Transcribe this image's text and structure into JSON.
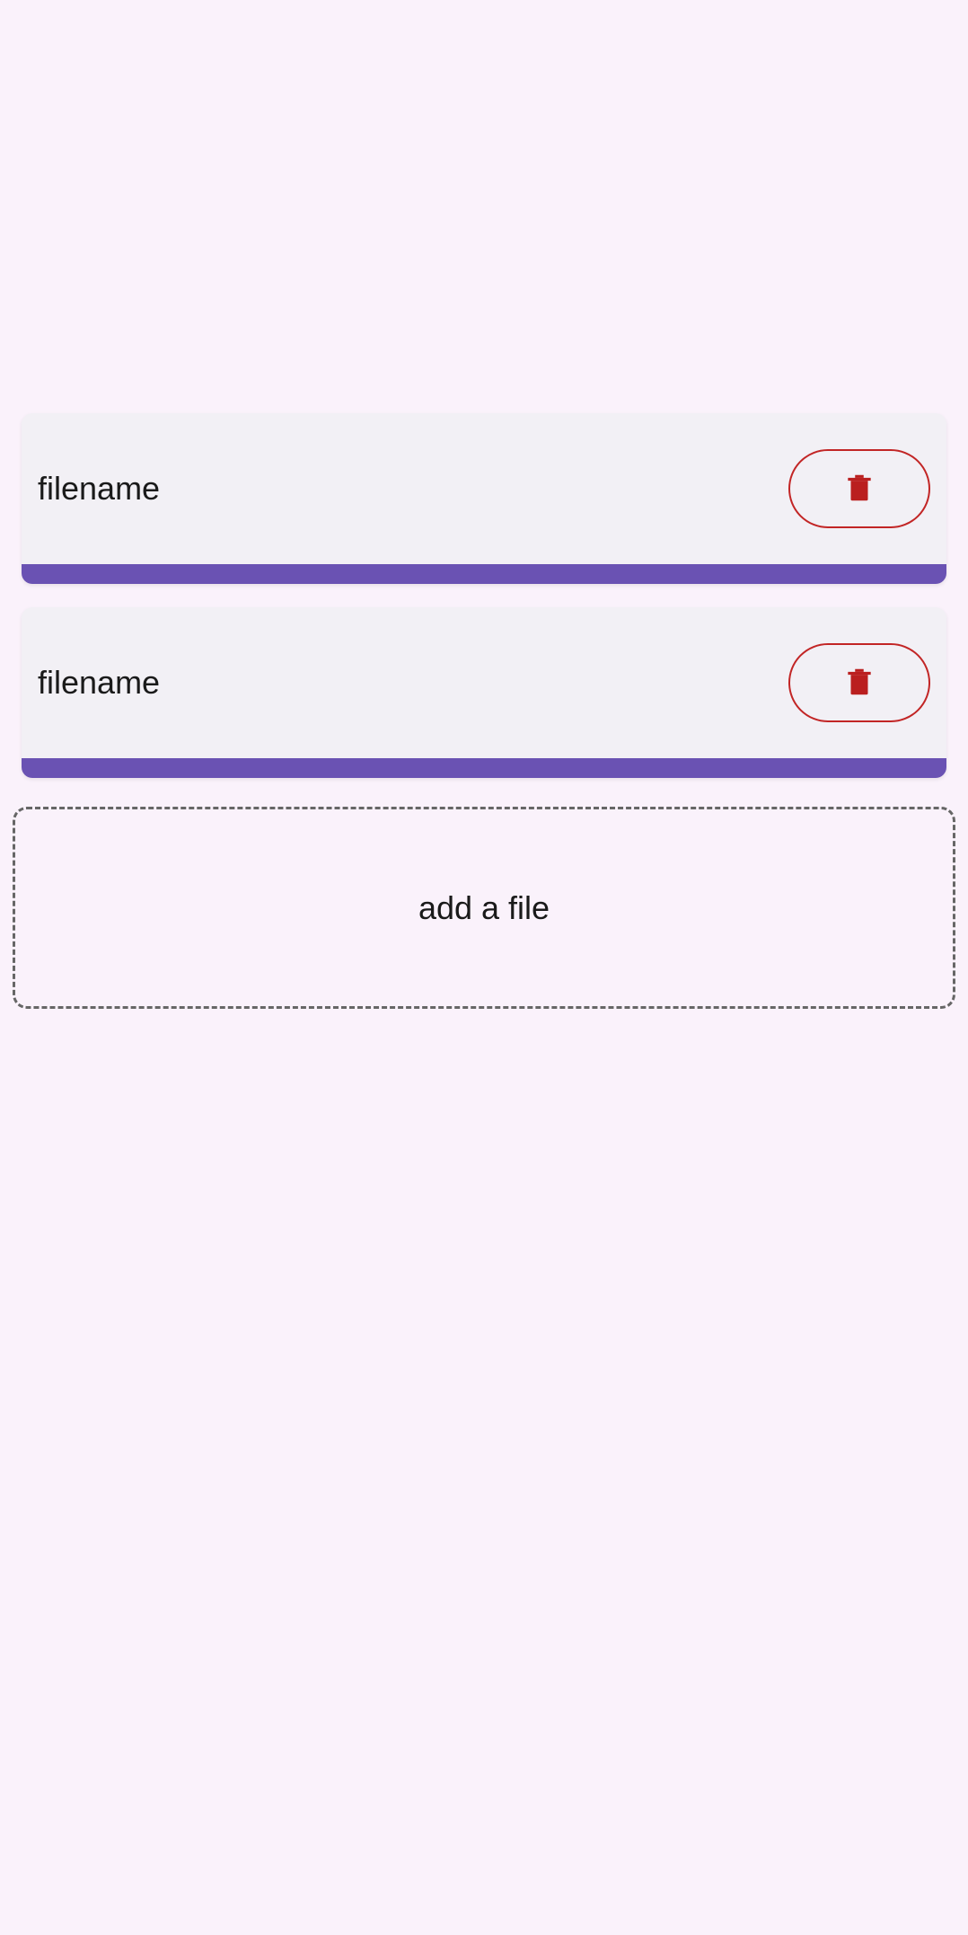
{
  "files": [
    {
      "name": "filename"
    },
    {
      "name": "filename"
    }
  ],
  "addZone": {
    "label": "add a file"
  },
  "colors": {
    "background": "#faf2fb",
    "card": "#f2f0f5",
    "progress": "#6a52b3",
    "deleteOutline": "#c22525",
    "deleteIcon": "#ba1f1f"
  }
}
